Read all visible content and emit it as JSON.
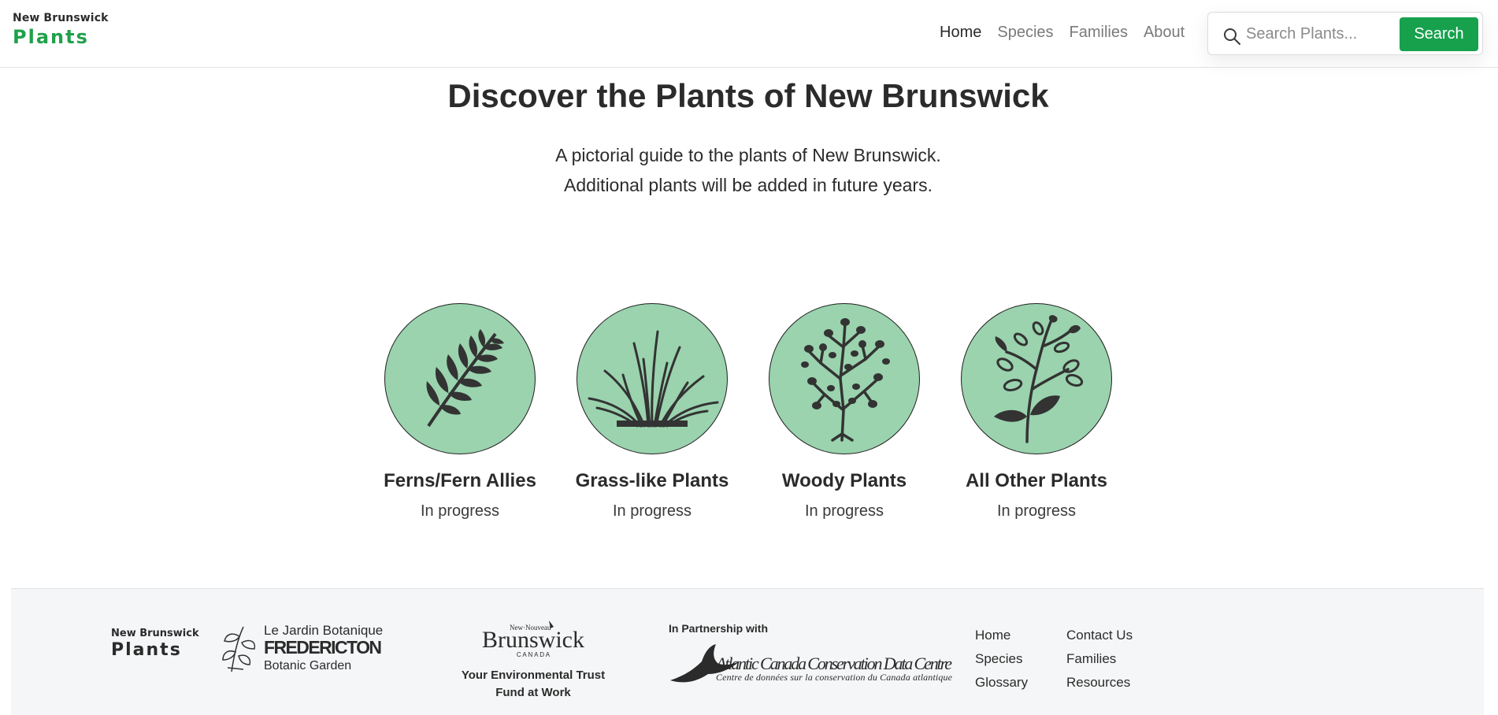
{
  "header": {
    "logo_top": "New Brunswick",
    "logo_bottom": "Plants",
    "nav": [
      "Home",
      "Species",
      "Families",
      "About"
    ],
    "search_placeholder": "Search Plants...",
    "search_button": "Search"
  },
  "hero": {
    "title": "Discover the Plants of New Brunswick",
    "subtitle_line1": "A pictorial guide to the plants of New Brunswick.",
    "subtitle_line2": "Additional plants will be added in future years."
  },
  "categories": [
    {
      "title": "Ferns/Fern Allies",
      "status": "In progress",
      "icon": "fern-icon"
    },
    {
      "title": "Grass-like Plants",
      "status": "In progress",
      "icon": "grass-icon"
    },
    {
      "title": "Woody Plants",
      "status": "In progress",
      "icon": "tree-icon"
    },
    {
      "title": "All Other Plants",
      "status": "In progress",
      "icon": "plant-icon"
    }
  ],
  "footer": {
    "logo_top": "New Brunswick",
    "logo_bottom": "Plants",
    "botanic_line1": "Le Jardin Botanique de",
    "botanic_line2": "FREDERICTON",
    "botanic_line3": "Botanic Garden",
    "nb_small": "New·Nouveau",
    "nb_name": "Brunswick",
    "nb_country": "C A N A D A",
    "nb_fund_line1": "Your Environmental Trust",
    "nb_fund_line2": "Fund at Work",
    "partner_label": "In Partnership with",
    "partner_name": "Atlantic Canada Conservation Data Centre",
    "partner_name_fr": "Centre de données sur la conservation du Canada atlantique",
    "links_col1": [
      "Home",
      "Species",
      "Glossary"
    ],
    "links_col2": [
      "Contact Us",
      "Families",
      "Resources"
    ]
  },
  "colors": {
    "brand_green": "#1fa14b",
    "button_green": "#17a14d",
    "circle_fill": "#9ad3ae",
    "footer_bg": "#f5f6f7"
  }
}
